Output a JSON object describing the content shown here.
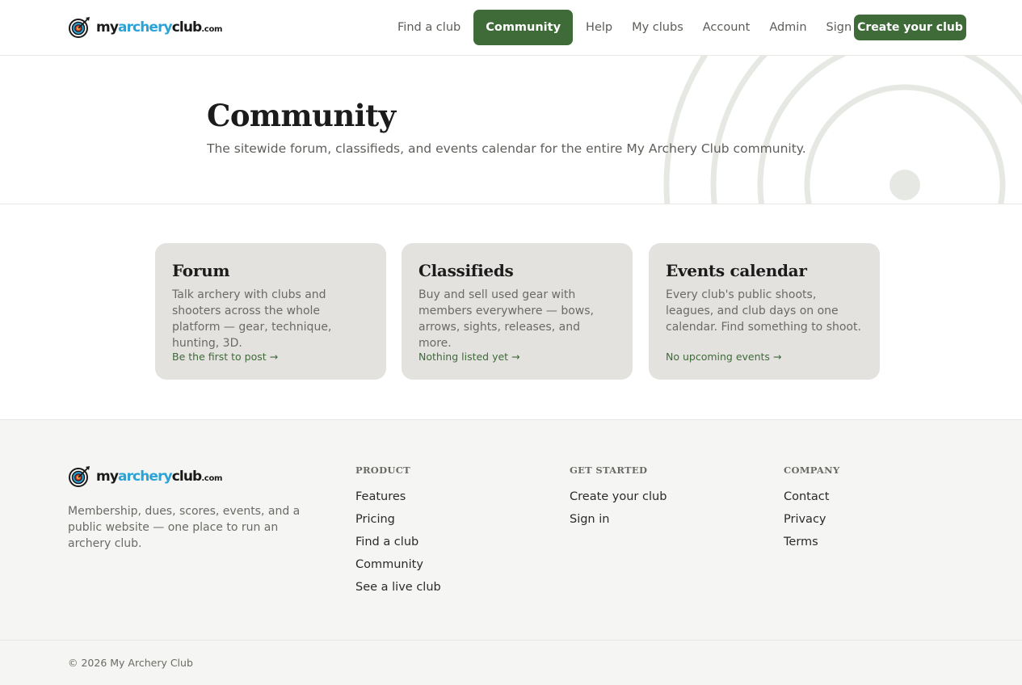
{
  "brand": {
    "name_prefix": "my",
    "name_accent": "archery",
    "name_suffix": "club",
    "name_tld": ".com",
    "accent_color": "#2ba3d6",
    "primary_color": "#3f6b38",
    "logo_icon": "archery-target-icon"
  },
  "nav": {
    "items": [
      {
        "label": "Find a club",
        "active": false
      },
      {
        "label": "Community",
        "active": true
      },
      {
        "label": "Help",
        "active": false
      },
      {
        "label": "My clubs",
        "active": false
      },
      {
        "label": "Account",
        "active": false
      },
      {
        "label": "Admin",
        "active": false
      },
      {
        "label": "Sign out",
        "active": false
      }
    ],
    "cta_label": "Create your club"
  },
  "hero": {
    "title": "Community",
    "subtitle": "The sitewide forum, classifieds, and events calendar for the entire My Archery Club community."
  },
  "cards": [
    {
      "title": "Forum",
      "description": "Talk archery with clubs and shooters across the whole platform — gear, technique, hunting, 3D.",
      "link": "Be the first to post →"
    },
    {
      "title": "Classifieds",
      "description": "Buy and sell used gear with members everywhere — bows, arrows, sights, releases, and more.",
      "link": "Nothing listed yet →"
    },
    {
      "title": "Events calendar",
      "description": "Every club's public shoots, leagues, and club days on one calendar. Find something to shoot.",
      "link": "No upcoming events →"
    }
  ],
  "footer": {
    "tagline": "Membership, dues, scores, events, and a public website — one place to run an archery club.",
    "columns": [
      {
        "heading": "PRODUCT",
        "links": [
          "Features",
          "Pricing",
          "Find a club",
          "Community",
          "See a live club"
        ]
      },
      {
        "heading": "GET STARTED",
        "links": [
          "Create your club",
          "Sign in"
        ]
      },
      {
        "heading": "COMPANY",
        "links": [
          "Contact",
          "Privacy",
          "Terms"
        ]
      }
    ],
    "copyright": "© 2026 My Archery Club"
  }
}
